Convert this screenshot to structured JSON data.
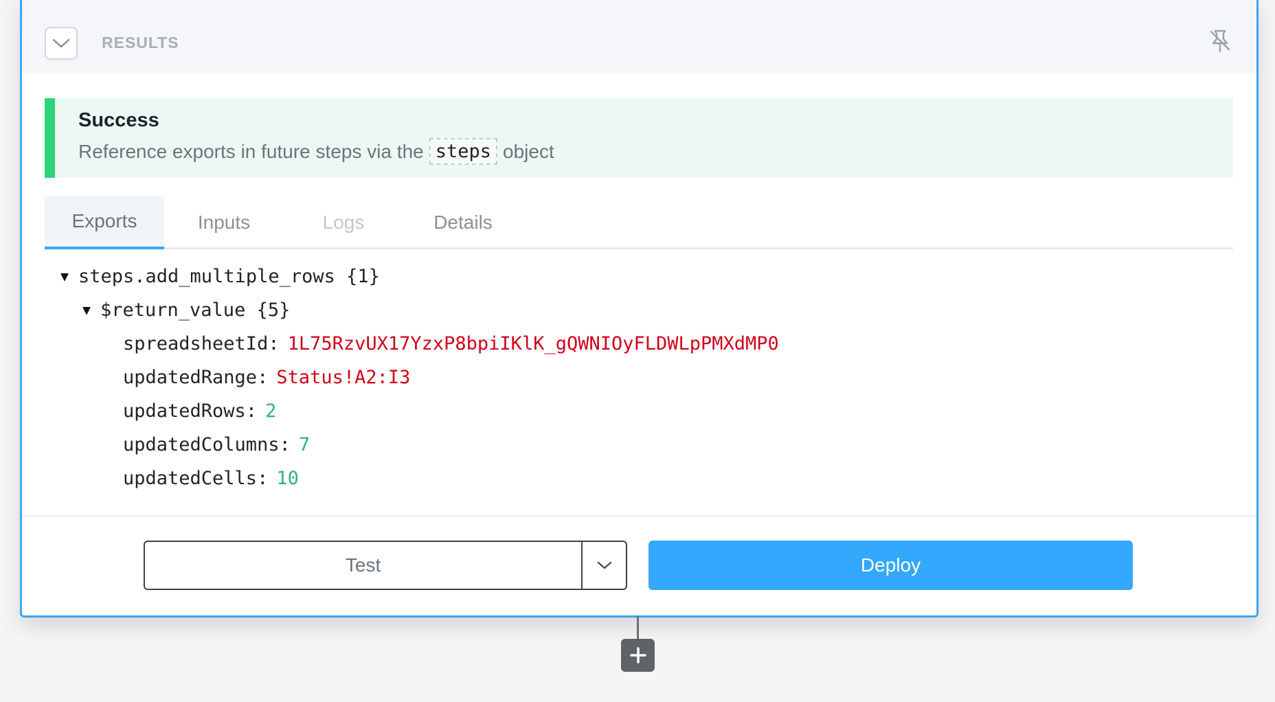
{
  "results": {
    "title": "RESULTS",
    "collapse_icon": "chevron-down-icon",
    "pin_icon": "unpin-icon"
  },
  "alert": {
    "title": "Success",
    "message_before": "Reference exports in future steps via the",
    "code": "steps",
    "message_after": "object",
    "accent_color": "#2ed47a"
  },
  "tabs": [
    {
      "label": "Exports",
      "state": "active"
    },
    {
      "label": "Inputs",
      "state": "normal"
    },
    {
      "label": "Logs",
      "state": "disabled"
    },
    {
      "label": "Details",
      "state": "normal"
    }
  ],
  "tree": {
    "root": {
      "label": "steps.add_multiple_rows {1}",
      "expanded": true
    },
    "child": {
      "label": "$return_value {5}",
      "expanded": true
    },
    "fields": [
      {
        "key": "spreadsheetId:",
        "value": "1L75RzvUX17YzxP8bpiIKlK_gQWNIOyFLDWLpPMXdMP0",
        "type": "string"
      },
      {
        "key": "updatedRange:",
        "value": "Status!A2:I3",
        "type": "string"
      },
      {
        "key": "updatedRows:",
        "value": "2",
        "type": "number"
      },
      {
        "key": "updatedColumns:",
        "value": "7",
        "type": "number"
      },
      {
        "key": "updatedCells:",
        "value": "10",
        "type": "number"
      }
    ]
  },
  "footer": {
    "test_label": "Test",
    "deploy_label": "Deploy",
    "deploy_color": "#33a8fc"
  },
  "add_step_icon": "plus-icon"
}
